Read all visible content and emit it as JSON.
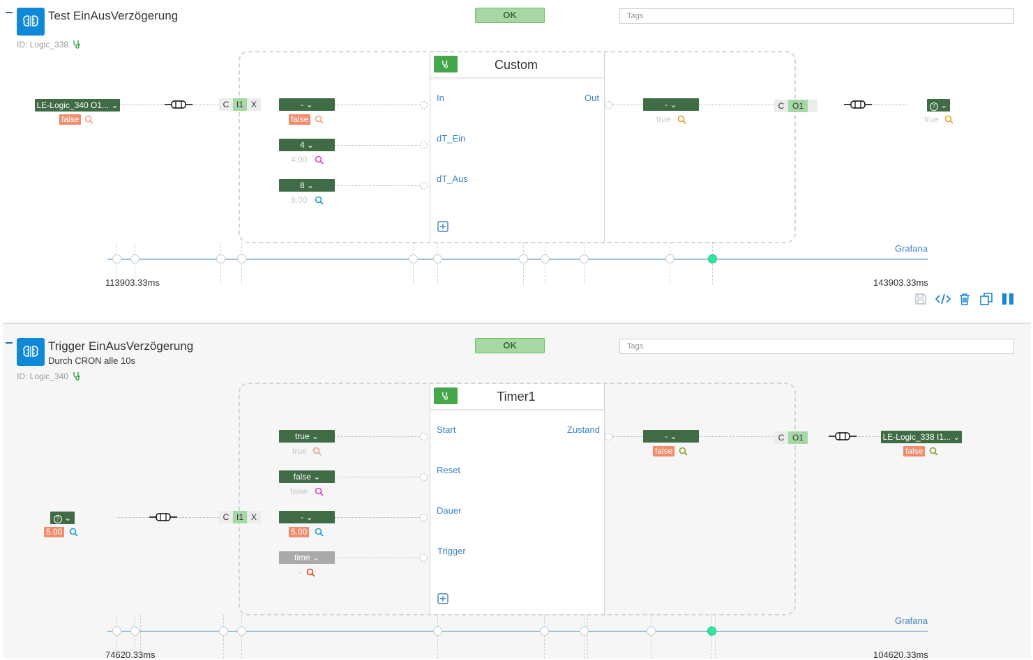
{
  "colors": {
    "accent": "#0f88d8",
    "pill": "#3f6b45",
    "ok": "#a7d8a3",
    "false_badge": "#f08c6c",
    "link": "#3b82c4"
  },
  "tags_placeholder": "Tags",
  "logic1": {
    "title": "Test EinAusVerzögerung",
    "id": "ID: Logic_338",
    "status": "OK",
    "block_title": "Custom",
    "ports_in": [
      "In",
      "dT_Ein",
      "dT_Aus"
    ],
    "port_out": "Out",
    "source": {
      "label": "LE-Logic_340 O1...",
      "value": "false"
    },
    "inputs": [
      {
        "label": "-",
        "value": "false"
      },
      {
        "label": "4",
        "value": "4.00"
      },
      {
        "label": "8",
        "value": "8.00"
      }
    ],
    "output": {
      "label": "-",
      "value": "true"
    },
    "target": {
      "label": "?",
      "value": "true"
    },
    "cix": {
      "c": "C",
      "i": "I1",
      "x": "X"
    },
    "co": {
      "c": "C",
      "o": "O1"
    },
    "timeline": {
      "start": "113903.33ms",
      "end": "143903.33ms",
      "link": "Grafana"
    }
  },
  "logic2": {
    "title": "Trigger EinAusVerzögerung",
    "subtitle": "Durch CRON alle 10s",
    "id": "ID: Logic_340",
    "status": "OK",
    "block_title": "Timer1",
    "ports_in": [
      "Start",
      "Reset",
      "Dauer",
      "Trigger"
    ],
    "port_out": "Zustand",
    "source": {
      "label": "?",
      "value": "5.00"
    },
    "inputs": [
      {
        "label": "true",
        "value": "true"
      },
      {
        "label": "false",
        "value": "false"
      },
      {
        "label": "-",
        "value": "5.00"
      },
      {
        "label": "time",
        "value": "-"
      }
    ],
    "output": {
      "label": "-",
      "value": "false"
    },
    "target": {
      "label": "LE-Logic_338 I1...",
      "value": "false"
    },
    "cix": {
      "c": "C",
      "i": "I1",
      "x": "X"
    },
    "co": {
      "c": "C",
      "o": "O1"
    },
    "timeline": {
      "start": "74620.33ms",
      "end": "104620.33ms",
      "link": "Grafana"
    }
  }
}
